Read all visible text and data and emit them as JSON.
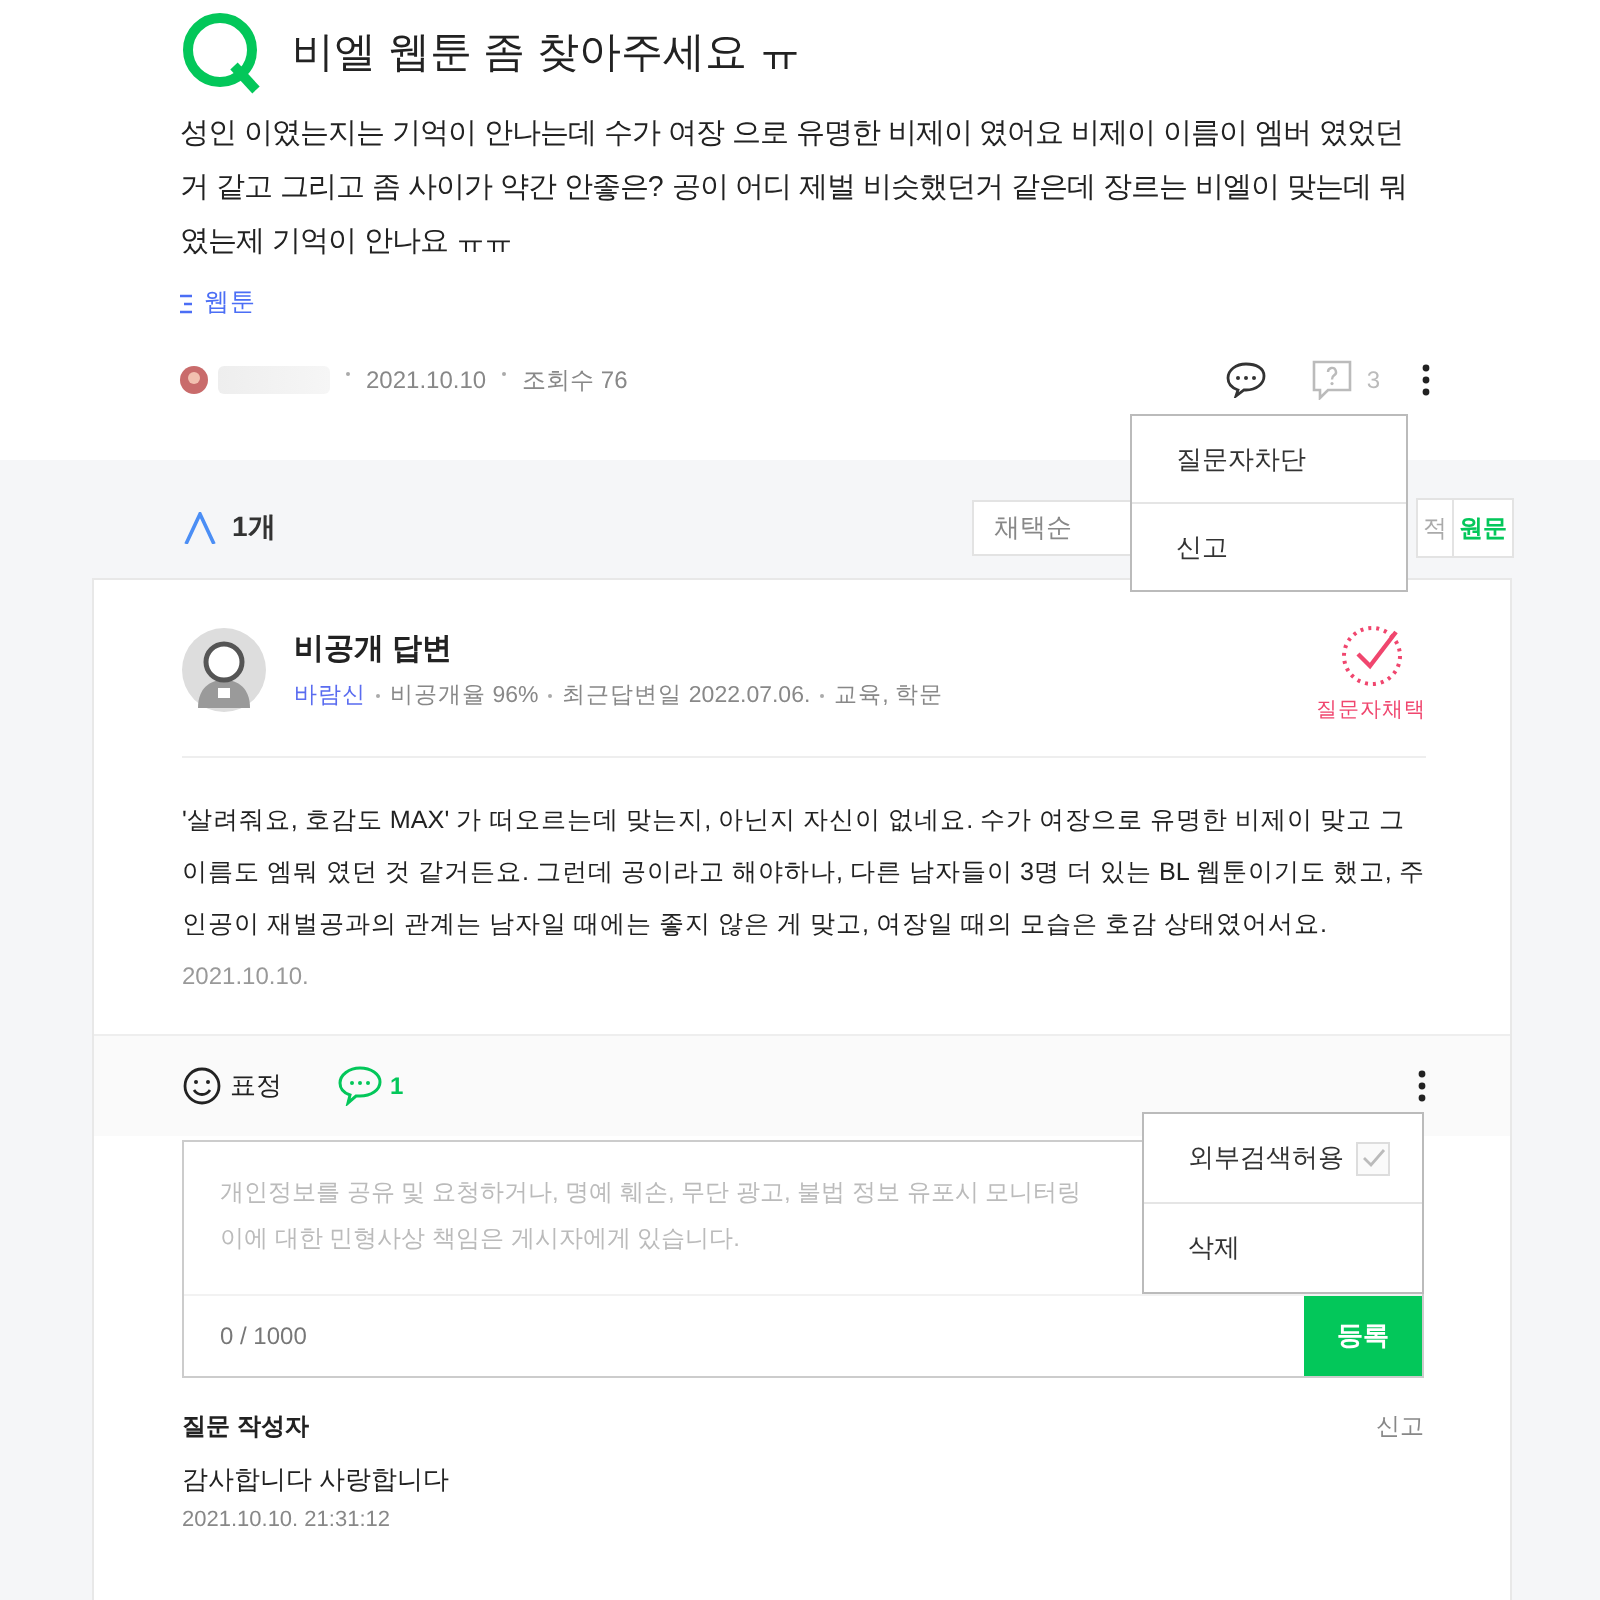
{
  "question": {
    "title": "비엘 웹툰 좀 찾아주세요 ㅠ",
    "body": "성인 이였는지는 기억이 안나는데 수가 여장 으로 유명한 비제이 였어요 비제이 이름이 엠버 였었던거 같고 그리고 좀 사이가 약간 안좋은? 공이 어디 제벌 비슷했던거 같은데 장르는 비엘이 맞는데 뭐였는제 기억이 안나요 ㅠㅠ",
    "category": "웹툰",
    "date": "2021.10.10",
    "views": "조회수 76",
    "question_count": "3"
  },
  "question_menu": {
    "items": [
      "질문자차단",
      "신고"
    ]
  },
  "answers_header": {
    "count": "1개",
    "sort": "채택순",
    "filters": [
      {
        "label": "적",
        "selected": false
      },
      {
        "label": "원문",
        "selected": true
      }
    ]
  },
  "answer": {
    "title": "비공개 답변",
    "author": "바람신",
    "meta": [
      "비공개율 96%",
      "최근답변일 2022.07.06.",
      "교육, 학문"
    ],
    "badge": "질문자채택",
    "body": "'살려줘요, 호감도 MAX' 가 떠오르는데 맞는지, 아닌지 자신이 없네요. 수가 여장으로 유명한 비제이 맞고 그 이름도 엠뭐 였던 것 같거든요. 그런데 공이라고 해야하나, 다른 남자들이 3명 더 있는 BL 웹툰이기도 했고, 주인공이 재벌공과의 관계는 남자일 때에는 좋지 않은 게 맞고, 여장일 때의 모습은 호감 상태였어서요.",
    "date": "2021.10.10."
  },
  "answer_footer": {
    "reaction": "표정",
    "comments": "1"
  },
  "comment_form": {
    "placeholder": "개인정보를 공유 및 요청하거나, 명예 훼손, 무단 광고, 불법 정보 유포시 모니터링\n이에 대한 민형사상 책임은 게시자에게 있습니다.",
    "counter": "0 / 1000",
    "submit": "등록"
  },
  "answer_menu": {
    "items": [
      {
        "label": "외부검색허용",
        "kind": "checkbox",
        "checked": true
      },
      {
        "label": "삭제",
        "kind": "plain"
      }
    ]
  },
  "comments": [
    {
      "author": "질문 작성자",
      "action": "신고",
      "text": "감사합니다 사랑합니다",
      "time": "2021.10.10. 21:31:12"
    }
  ]
}
